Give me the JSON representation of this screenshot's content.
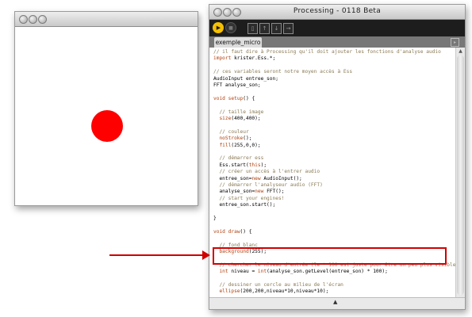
{
  "sketch_window": {
    "circle_color": "#ff0000"
  },
  "pde_window": {
    "title": "Processing - 0118 Beta",
    "tab_label": "exemple_micro",
    "toolbar": {
      "run_icon": "play-icon",
      "stop_icon": "stop-icon",
      "run_glyph": "▶",
      "stop_glyph": "■",
      "file_buttons": [
        {
          "name": "new-file-icon",
          "glyph": "▯"
        },
        {
          "name": "open-file-icon",
          "glyph": "↑"
        },
        {
          "name": "save-file-icon",
          "glyph": "↓"
        },
        {
          "name": "export-file-icon",
          "glyph": "→"
        }
      ]
    },
    "tab_menu_glyph": "▸",
    "scroll_up_glyph": "▲",
    "scroll_down_glyph": "▼",
    "status_glyph": "▲",
    "accent_color": "#f6c000",
    "code_lines": [
      {
        "segments": [
          {
            "t": "// il faut dire à Processing qu'il doit ajouter les fonctions d'analyse audio",
            "c": "comment"
          }
        ]
      },
      {
        "segments": [
          {
            "t": "import",
            "c": "kw"
          },
          {
            "t": " krister.Ess.*;",
            "c": ""
          }
        ]
      },
      {
        "segments": []
      },
      {
        "segments": [
          {
            "t": "// ces variables seront notre moyen accès à Ess",
            "c": "comment"
          }
        ]
      },
      {
        "segments": [
          {
            "t": "AudioInput entree_son;",
            "c": ""
          }
        ]
      },
      {
        "segments": [
          {
            "t": "FFT analyse_son;",
            "c": ""
          }
        ]
      },
      {
        "segments": []
      },
      {
        "segments": [
          {
            "t": "void",
            "c": "kw"
          },
          {
            "t": " ",
            "c": ""
          },
          {
            "t": "setup",
            "c": "kw"
          },
          {
            "t": "() {",
            "c": ""
          }
        ]
      },
      {
        "segments": []
      },
      {
        "segments": [
          {
            "t": "  // taille image",
            "c": "comment"
          }
        ]
      },
      {
        "segments": [
          {
            "t": "  ",
            "c": ""
          },
          {
            "t": "size",
            "c": "kw"
          },
          {
            "t": "(400,400);",
            "c": ""
          }
        ]
      },
      {
        "segments": []
      },
      {
        "segments": [
          {
            "t": "  // couleur",
            "c": "comment"
          }
        ]
      },
      {
        "segments": [
          {
            "t": "  ",
            "c": ""
          },
          {
            "t": "noStroke",
            "c": "kw"
          },
          {
            "t": "();",
            "c": ""
          }
        ]
      },
      {
        "segments": [
          {
            "t": "  ",
            "c": ""
          },
          {
            "t": "fill",
            "c": "kw"
          },
          {
            "t": "(255,0,0);",
            "c": ""
          }
        ]
      },
      {
        "segments": []
      },
      {
        "segments": [
          {
            "t": "  // démarrer ess",
            "c": "comment"
          }
        ]
      },
      {
        "segments": [
          {
            "t": "  Ess.start(",
            "c": ""
          },
          {
            "t": "this",
            "c": "kw"
          },
          {
            "t": ");",
            "c": ""
          }
        ]
      },
      {
        "segments": [
          {
            "t": "  // créer un accès à l'entrer audio",
            "c": "comment"
          }
        ]
      },
      {
        "segments": [
          {
            "t": "  entree_son=",
            "c": ""
          },
          {
            "t": "new",
            "c": "kw"
          },
          {
            "t": " AudioInput();",
            "c": ""
          }
        ]
      },
      {
        "segments": [
          {
            "t": "  // démarrer l'analyseur audio (FFT)",
            "c": "comment"
          }
        ]
      },
      {
        "segments": [
          {
            "t": "  analyse_son=",
            "c": ""
          },
          {
            "t": "new",
            "c": "kw"
          },
          {
            "t": " FFT();",
            "c": ""
          }
        ]
      },
      {
        "segments": [
          {
            "t": "  // start your engines!",
            "c": "comment"
          }
        ]
      },
      {
        "segments": [
          {
            "t": "  entree_son.start();",
            "c": ""
          }
        ]
      },
      {
        "segments": []
      },
      {
        "segments": [
          {
            "t": "}",
            "c": ""
          }
        ]
      },
      {
        "segments": []
      },
      {
        "segments": [
          {
            "t": "void",
            "c": "kw"
          },
          {
            "t": " ",
            "c": ""
          },
          {
            "t": "draw",
            "c": "kw"
          },
          {
            "t": "() {",
            "c": ""
          }
        ]
      },
      {
        "segments": []
      },
      {
        "segments": [
          {
            "t": "  // fond blanc",
            "c": "comment"
          }
        ]
      },
      {
        "segments": [
          {
            "t": "  ",
            "c": ""
          },
          {
            "t": "background",
            "c": "kw"
          },
          {
            "t": "(255);",
            "c": ""
          }
        ]
      },
      {
        "segments": []
      },
      {
        "segments": [
          {
            "t": "  // chercher le niveau d'entrée (le * 100 est juste pour être un peu plus visible)",
            "c": "comment"
          }
        ]
      },
      {
        "segments": [
          {
            "t": "  ",
            "c": ""
          },
          {
            "t": "int",
            "c": "kw"
          },
          {
            "t": " niveau = ",
            "c": ""
          },
          {
            "t": "int",
            "c": "kw"
          },
          {
            "t": "(analyse_son.getLevel(entree_son) * 100);",
            "c": ""
          }
        ]
      },
      {
        "segments": []
      },
      {
        "segments": [
          {
            "t": "  // dessiner un cercle au milieu de l'écran",
            "c": "comment"
          }
        ]
      },
      {
        "segments": [
          {
            "t": "  ",
            "c": ""
          },
          {
            "t": "ellipse",
            "c": "kw"
          },
          {
            "t": "(200,200,niveau*10,niveau*10);",
            "c": ""
          }
        ]
      },
      {
        "segments": []
      },
      {
        "segments": [
          {
            "t": "}",
            "c": ""
          }
        ]
      }
    ]
  },
  "annotation": {
    "color": "#d10000"
  }
}
